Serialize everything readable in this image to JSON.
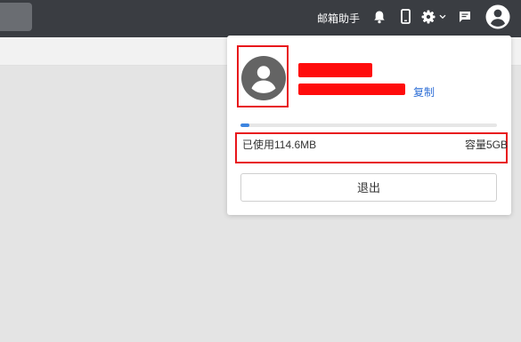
{
  "header": {
    "assistant_label": "邮箱助手",
    "icons": [
      "bell-icon",
      "phone-icon",
      "gear-icon",
      "chevron-down-icon",
      "chat-icon",
      "user-avatar-icon"
    ]
  },
  "account_panel": {
    "copy_label": "复制",
    "storage": {
      "used_label": "已使用114.6MB",
      "capacity_label": "容量5GB",
      "used_fraction": 0.022
    },
    "logout_label": "退出"
  },
  "colors": {
    "topbar": "#3a3d42",
    "accent": "#3d85e0",
    "highlight_box": "#e8161b"
  }
}
